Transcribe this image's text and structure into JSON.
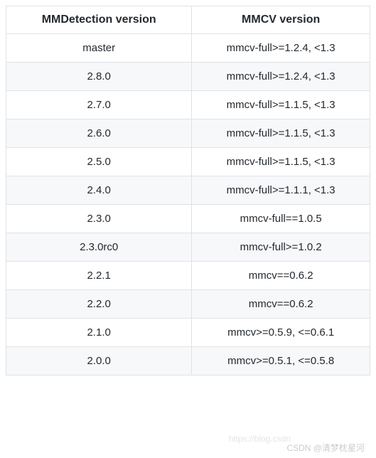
{
  "chart_data": {
    "type": "table",
    "title": "",
    "headers": [
      "MMDetection version",
      "MMCV version"
    ],
    "rows": [
      [
        "master",
        "mmcv-full>=1.2.4, <1.3"
      ],
      [
        "2.8.0",
        "mmcv-full>=1.2.4, <1.3"
      ],
      [
        "2.7.0",
        "mmcv-full>=1.1.5, <1.3"
      ],
      [
        "2.6.0",
        "mmcv-full>=1.1.5, <1.3"
      ],
      [
        "2.5.0",
        "mmcv-full>=1.1.5, <1.3"
      ],
      [
        "2.4.0",
        "mmcv-full>=1.1.1, <1.3"
      ],
      [
        "2.3.0",
        "mmcv-full==1.0.5"
      ],
      [
        "2.3.0rc0",
        "mmcv-full>=1.0.2"
      ],
      [
        "2.2.1",
        "mmcv==0.6.2"
      ],
      [
        "2.2.0",
        "mmcv==0.6.2"
      ],
      [
        "2.1.0",
        "mmcv>=0.5.9, <=0.6.1"
      ],
      [
        "2.0.0",
        "mmcv>=0.5.1, <=0.5.8"
      ]
    ]
  },
  "watermark": {
    "url": "https://blog.csdn",
    "attribution": "CSDN @清梦枕星河"
  }
}
